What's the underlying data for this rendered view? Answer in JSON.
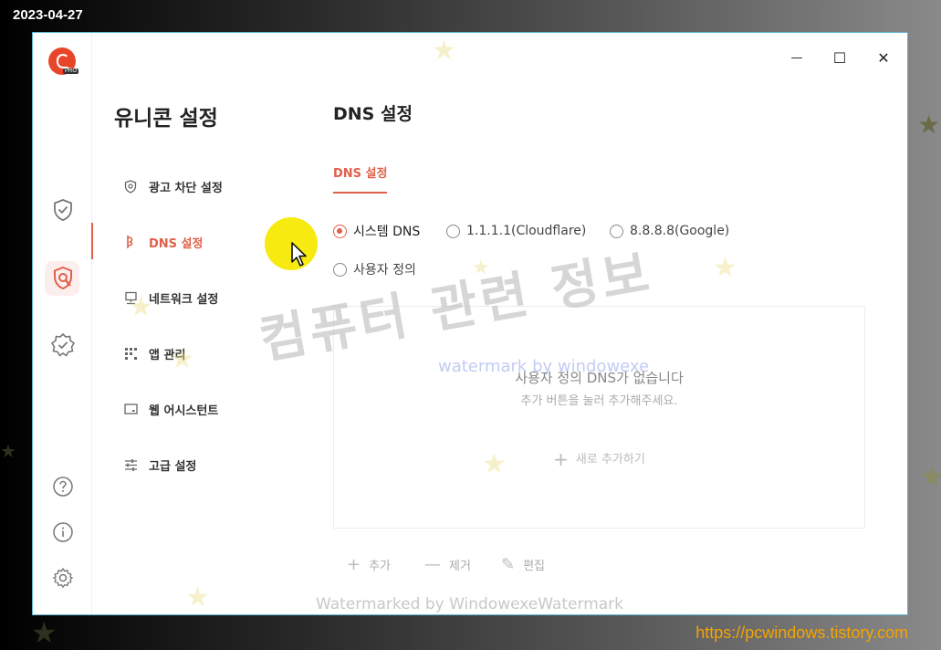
{
  "overlay": {
    "date_stamp": "2023-04-27",
    "site_url": "https://pcwindows.tistory.com",
    "watermark_main": "컴퓨터 관련 정보",
    "watermark_sub": "watermark by windowexe",
    "watermark_bottom": "Watermarked by WindowexeWatermark"
  },
  "app": {
    "logo_badge": "PRO",
    "rail_icons": [
      "shield-check-icon",
      "shield-wrench-icon",
      "badge-check-icon",
      "help-icon",
      "info-icon",
      "settings-icon"
    ],
    "window_controls": {
      "minimize": "—",
      "maximize": "☐",
      "close": "✕"
    }
  },
  "sidebar": {
    "title": "유니콘 설정",
    "items": [
      {
        "label": "광고 차단 설정",
        "icon": "shield-icon",
        "active": false
      },
      {
        "label": "DNS 설정",
        "icon": "dns-icon",
        "active": true
      },
      {
        "label": "네트워크 설정",
        "icon": "network-icon",
        "active": false
      },
      {
        "label": "앱 관리",
        "icon": "apps-icon",
        "active": false
      },
      {
        "label": "웹 어시스턴트",
        "icon": "web-assistant-icon",
        "active": false
      },
      {
        "label": "고급 설정",
        "icon": "sliders-icon",
        "active": false
      }
    ]
  },
  "main": {
    "title": "DNS 설정",
    "tab": "DNS 설정",
    "dns_options": [
      {
        "label": "시스템 DNS",
        "selected": true
      },
      {
        "label": "1.1.1.1(Cloudflare)",
        "selected": false
      },
      {
        "label": "8.8.8.8(Google)",
        "selected": false
      },
      {
        "label": "사용자 정의",
        "selected": false
      }
    ],
    "empty_title": "사용자 정의 DNS가 없습니다",
    "empty_sub": "추가 버튼을 눌러 추가해주세요.",
    "add_new": "새로 추가하기",
    "actions": {
      "add": "추가",
      "remove": "제거",
      "edit": "편집"
    }
  },
  "colors": {
    "accent": "#e0604a",
    "logo": "#e8462a",
    "border": "#5ab3d6"
  }
}
